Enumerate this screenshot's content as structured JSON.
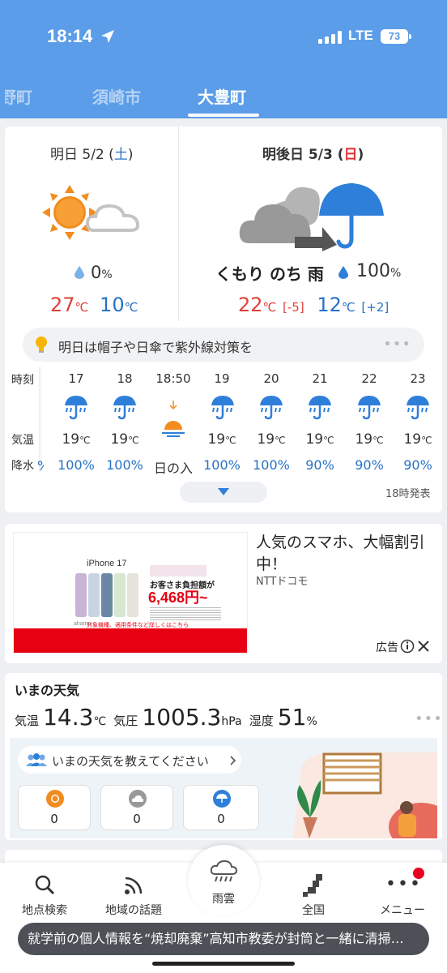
{
  "status_bar": {
    "time": "18:14",
    "network": "LTE",
    "battery": "73"
  },
  "tabs": [
    {
      "label": "野町"
    },
    {
      "label": "須崎市"
    },
    {
      "label": "大豊町"
    }
  ],
  "forecast": {
    "tomorrow": {
      "label": "明日 5/2 (",
      "dow": "土",
      "close": ")",
      "precip": "0",
      "precip_unit": "%",
      "high": "27",
      "low": "10",
      "unit": "℃"
    },
    "day_after": {
      "label": "明後日 5/3 (",
      "dow": "日",
      "close": ")",
      "condition": "くもり のち 雨",
      "precip": "100",
      "precip_unit": "%",
      "high": "22",
      "high_diff": "[-5]",
      "low": "12",
      "low_diff": "[+2]",
      "unit": "℃"
    },
    "tip": "明日は帽子や日傘で紫外線対策を"
  },
  "hourly": {
    "labels": {
      "time": "時刻",
      "temp": "気温",
      "precip": "降水"
    },
    "partial_precip": "%",
    "hours": [
      {
        "time": "17",
        "icon": "umbrella-rain-icon",
        "temp": "19",
        "precip": "100%"
      },
      {
        "time": "18",
        "icon": "umbrella-rain-icon",
        "temp": "19",
        "precip": "100%"
      },
      {
        "time": "18:50",
        "icon": "sunset-icon",
        "temp": "",
        "precip": "日の入"
      },
      {
        "time": "19",
        "icon": "umbrella-rain-icon",
        "temp": "19",
        "precip": "100%"
      },
      {
        "time": "20",
        "icon": "umbrella-rain-icon",
        "temp": "19",
        "precip": "100%"
      },
      {
        "time": "21",
        "icon": "umbrella-rain-icon",
        "temp": "19",
        "precip": "90%"
      },
      {
        "time": "22",
        "icon": "umbrella-rain-icon",
        "temp": "19",
        "precip": "90%"
      },
      {
        "time": "23",
        "icon": "umbrella-rain-icon",
        "temp": "19",
        "precip": "90%"
      }
    ],
    "temp_unit": "℃",
    "issued": "18時発表"
  },
  "ad": {
    "title": "人気のスマホ、大幅割引中！",
    "sponsor": "NTTドコモ",
    "label": "広告",
    "image_texts": {
      "brand": "iPhone 17",
      "banner": "お客さま負担額が",
      "price": "6,468円~",
      "footer": "対象機種、適用条件など詳しくはこちら",
      "logo": "ahamo"
    },
    "colors": {
      "accent": "#e60012"
    }
  },
  "current": {
    "title": "いまの天気",
    "temp_label": "気温",
    "temp": "14.3",
    "temp_unit": "℃",
    "pressure_label": "気圧",
    "pressure": "1005.3",
    "pressure_unit": "hPa",
    "humidity_label": "湿度",
    "humidity": "51",
    "humidity_unit": "%",
    "report_prompt": "いまの天気を教えてください",
    "reports": [
      {
        "icon": "sun-icon",
        "count": "0"
      },
      {
        "icon": "cloud-icon",
        "count": "0"
      },
      {
        "icon": "umbrella-icon",
        "count": "0"
      }
    ]
  },
  "nav": [
    {
      "label": "地点検索",
      "icon": "search-icon"
    },
    {
      "label": "地域の話題",
      "icon": "rss-icon"
    },
    {
      "label": "雨雲",
      "icon": "rain-cloud-icon"
    },
    {
      "label": "全国",
      "icon": "japan-map-icon"
    },
    {
      "label": "メニュー",
      "icon": "more-icon"
    }
  ],
  "toast": "就学前の個人情報を“焼却廃棄”高知市教委が封筒と一緒に清掃…",
  "colors": {
    "header": "#5b9de8",
    "rain_blue": "#2872c4",
    "hot_red": "#e0413c",
    "sun_orange": "#f28c1e"
  }
}
